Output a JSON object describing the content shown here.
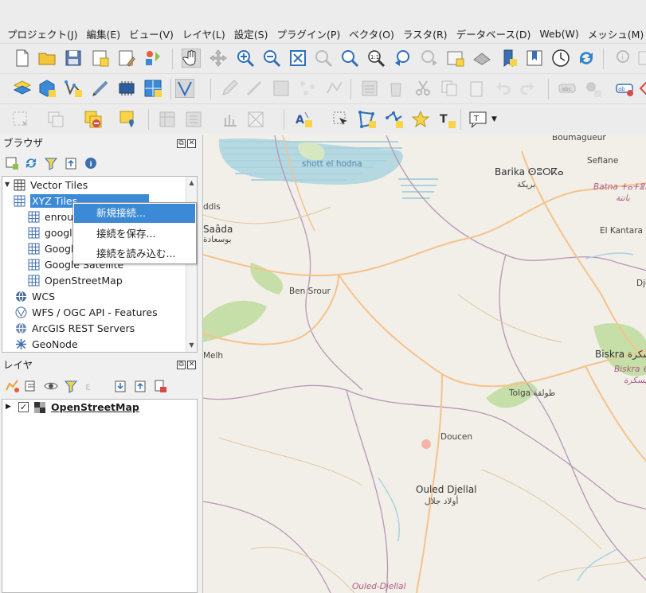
{
  "menubar": {
    "items": [
      "プロジェクト(J)",
      "編集(E)",
      "ビュー(V)",
      "レイヤ(L)",
      "設定(S)",
      "プラグイン(P)",
      "ベクタ(O)",
      "ラスタ(R)",
      "データベース(D)",
      "Web(W)",
      "メッシュ(M)"
    ]
  },
  "browser_panel": {
    "title": "ブラウザ",
    "tree": [
      {
        "label": "Vector Tiles",
        "icon": "grid-icon"
      },
      {
        "label": "XYZ Tiles",
        "icon": "grid-icon",
        "selected": true
      },
      {
        "label": "enrout",
        "icon": "grid-icon"
      },
      {
        "label": "google",
        "icon": "grid-icon"
      },
      {
        "label": "Google",
        "icon": "grid-icon"
      },
      {
        "label": "Google Satellite",
        "icon": "grid-icon"
      },
      {
        "label": "OpenStreetMap",
        "icon": "grid-icon"
      },
      {
        "label": "WCS",
        "icon": "globe-icon"
      },
      {
        "label": "WFS / OGC API - Features",
        "icon": "wfs-icon"
      },
      {
        "label": "ArcGIS REST Servers",
        "icon": "globe-icon"
      },
      {
        "label": "GeoNode",
        "icon": "geonode-icon"
      }
    ]
  },
  "context_menu": {
    "items": [
      "新規接続...",
      "接続を保存...",
      "接続を読み込む..."
    ]
  },
  "layers_panel": {
    "title": "レイヤ",
    "layers": [
      {
        "label": "OpenStreetMap",
        "checked": true
      }
    ]
  },
  "map": {
    "labels": [
      {
        "text": "Boumagueur",
        "cls": ""
      },
      {
        "text": "Sefiane",
        "cls": ""
      },
      {
        "text": "Barika ⵙⵓⵔⴽⴰ",
        "cls": "big"
      },
      {
        "text": "بريكة",
        "cls": ""
      },
      {
        "text": "Batna ⵜⴰⵜⴻⵏⴰ",
        "cls": "red"
      },
      {
        "text": "باتنة",
        "cls": "red"
      },
      {
        "text": "shott el hodna",
        "cls": "blue"
      },
      {
        "text": "ddis",
        "cls": ""
      },
      {
        "text": "Saâda",
        "cls": "big"
      },
      {
        "text": "بوسعادة",
        "cls": ""
      },
      {
        "text": "El Kantara",
        "cls": ""
      },
      {
        "text": "Dje",
        "cls": ""
      },
      {
        "text": "Ben Srour",
        "cls": ""
      },
      {
        "text": "Melh",
        "cls": ""
      },
      {
        "text": "Biskra بسكرة",
        "cls": "big"
      },
      {
        "text": "Biskra ⴱⵙⴽⵔⴰ",
        "cls": "red"
      },
      {
        "text": "بسكرة",
        "cls": "red"
      },
      {
        "text": "Tolga طولقة",
        "cls": ""
      },
      {
        "text": "Doucen",
        "cls": ""
      },
      {
        "text": "Ouled Djellal",
        "cls": "big"
      },
      {
        "text": "أولاد جلال",
        "cls": ""
      },
      {
        "text": "Ouled-Djellal",
        "cls": "red"
      }
    ]
  }
}
